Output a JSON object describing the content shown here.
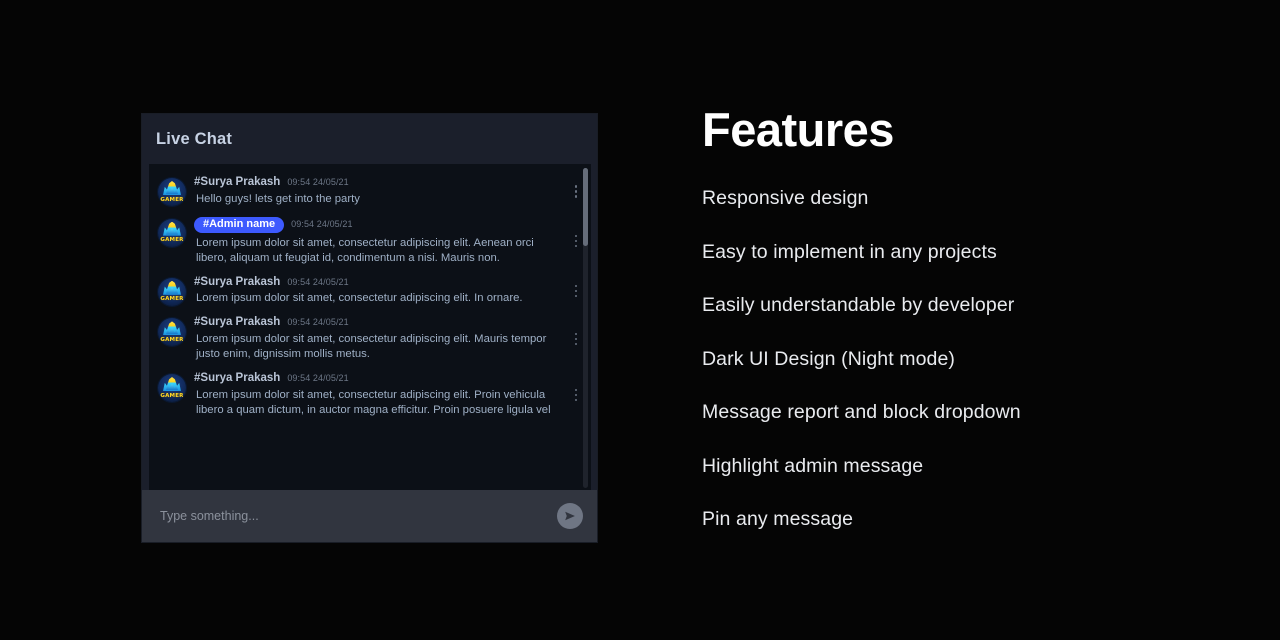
{
  "colors": {
    "page_background": "#050505",
    "panel_background": "#12161f",
    "panel_header": "#1b1f2b",
    "chat_background": "#0c1017",
    "composer_background": "#31353f",
    "admin_badge": "#3d5afe",
    "body_text": "#9fb0c6",
    "username_text": "#b9c4d6",
    "timestamp_text": "#6d7787",
    "feature_text": "#e9ebef",
    "send_button": "#6f7684",
    "scrollbar_thumb": "#666d7a"
  },
  "chat": {
    "title": "Live Chat",
    "avatar_label": "GAMER",
    "messages": [
      {
        "username": "#Surya Prakash",
        "is_admin": false,
        "timestamp": "09:54 24/05/21",
        "text": "Hello guys! lets get into the party"
      },
      {
        "username": "#Admin name",
        "is_admin": true,
        "timestamp": "09:54 24/05/21",
        "text": "Lorem ipsum dolor sit amet, consectetur adipiscing elit. Aenean orci libero, aliquam ut feugiat id, condimentum a nisi. Mauris non."
      },
      {
        "username": "#Surya Prakash",
        "is_admin": false,
        "timestamp": "09:54 24/05/21",
        "text": "Lorem ipsum dolor sit amet, consectetur adipiscing elit. In ornare."
      },
      {
        "username": "#Surya Prakash",
        "is_admin": false,
        "timestamp": "09:54 24/05/21",
        "text": "Lorem ipsum dolor sit amet, consectetur adipiscing elit. Mauris tempor justo enim, dignissim mollis metus."
      },
      {
        "username": "#Surya Prakash",
        "is_admin": false,
        "timestamp": "09:54 24/05/21",
        "text": "Lorem ipsum dolor sit amet, consectetur adipiscing elit. Proin vehicula libero a quam dictum, in auctor magna efficitur. Proin posuere ligula vel"
      }
    ],
    "composer": {
      "placeholder": "Type something...",
      "value": "",
      "send_icon": "send-icon"
    },
    "menu_icon": "kebab-menu-icon"
  },
  "features": {
    "title": "Features",
    "items": [
      "Responsive design",
      "Easy to implement in any projects",
      "Easily understandable by developer",
      "Dark UI Design (Night mode)",
      "Message report and block dropdown",
      "Highlight admin message",
      "Pin any message"
    ]
  }
}
